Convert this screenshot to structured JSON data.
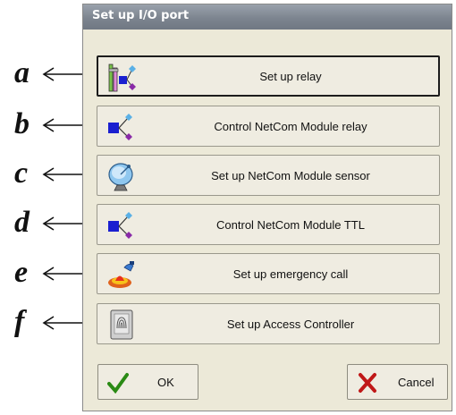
{
  "annotations": [
    "a",
    "b",
    "c",
    "d",
    "e",
    "f"
  ],
  "dialog": {
    "title": "Set up I/O port",
    "buttons": [
      {
        "label": "Set up relay",
        "icon": "relay-setup-icon"
      },
      {
        "label": "Control NetCom Module relay",
        "icon": "relay-control-icon"
      },
      {
        "label": "Set up NetCom Module sensor",
        "icon": "satellite-dish-icon"
      },
      {
        "label": "Control NetCom Module TTL",
        "icon": "ttl-control-icon"
      },
      {
        "label": "Set up emergency call",
        "icon": "alarm-siren-icon"
      },
      {
        "label": "Set up Access Controller",
        "icon": "fingerprint-reader-icon"
      }
    ],
    "ok": {
      "label": "OK",
      "icon": "checkmark-icon"
    },
    "cancel": {
      "label": "Cancel",
      "icon": "x-mark-icon"
    }
  },
  "colors": {
    "check": "#2a8a14",
    "cancel": "#c01818",
    "square": "#1a1fd0",
    "diamond": "#8a2aa8"
  }
}
